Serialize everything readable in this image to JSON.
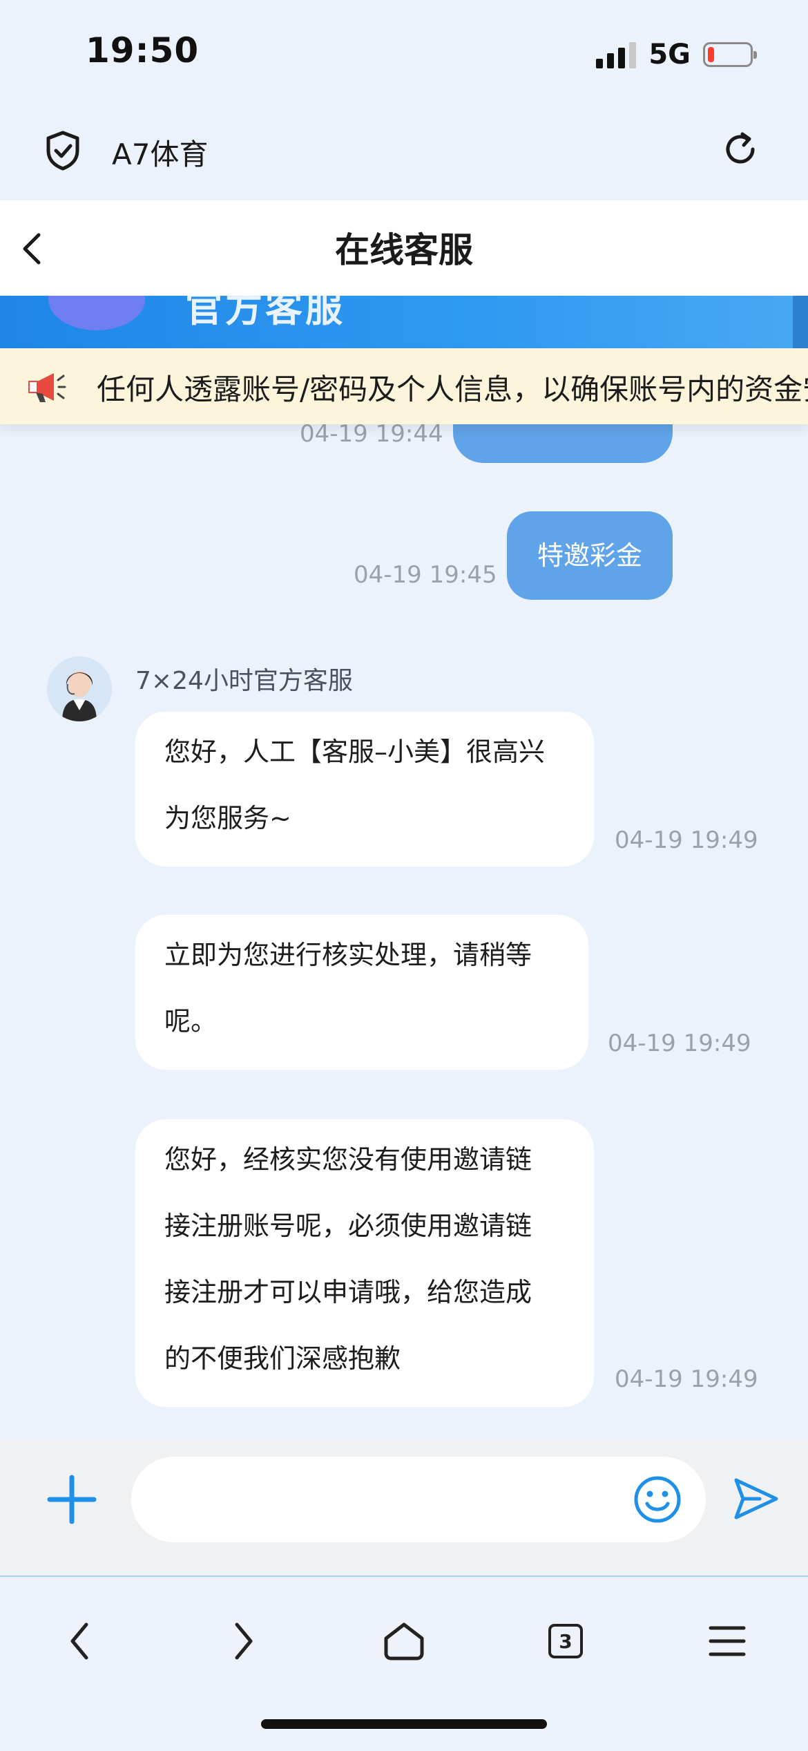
{
  "status_bar": {
    "time": "19:50",
    "network": "5G"
  },
  "browser": {
    "site_title": "A7体育"
  },
  "header": {
    "title": "在线客服"
  },
  "banner": {
    "text": "官方客服"
  },
  "notice": {
    "text": "任何人透露账号/密码及个人信息，以确保账号内的资金安"
  },
  "messages": {
    "out_1": {
      "time": "04-19 19:44",
      "text": ""
    },
    "out_2": {
      "time": "04-19 19:45",
      "text": "特邀彩金"
    },
    "agent_name": "7×24小时官方客服",
    "in_1": {
      "lines": [
        "您好，人工【客服–小美】很高兴",
        "为您服务~"
      ],
      "time": "04-19 19:49"
    },
    "in_2": {
      "lines": [
        "立即为您进行核实处理，请稍等",
        "呢。"
      ],
      "time": "04-19 19:49"
    },
    "in_3": {
      "lines": [
        "您好，经核实您没有使用邀请链",
        "接注册账号呢，必须使用邀请链",
        "接注册才可以申请哦，给您造成",
        "的不便我们深感抱歉"
      ],
      "time": "04-19 19:49"
    }
  },
  "input": {
    "placeholder": ""
  },
  "nav": {
    "tabs_count": "3"
  },
  "colors": {
    "accent": "#1e90e8",
    "bubble_out": "#5fa3e8",
    "notice_bg": "#fcf5dc"
  },
  "icons": [
    "shield-check-icon",
    "reload-icon",
    "back-chevron-icon",
    "megaphone-icon",
    "plus-icon",
    "emoji-icon",
    "send-icon",
    "nav-back-icon",
    "nav-forward-icon",
    "home-icon",
    "tabs-icon",
    "menu-icon"
  ]
}
